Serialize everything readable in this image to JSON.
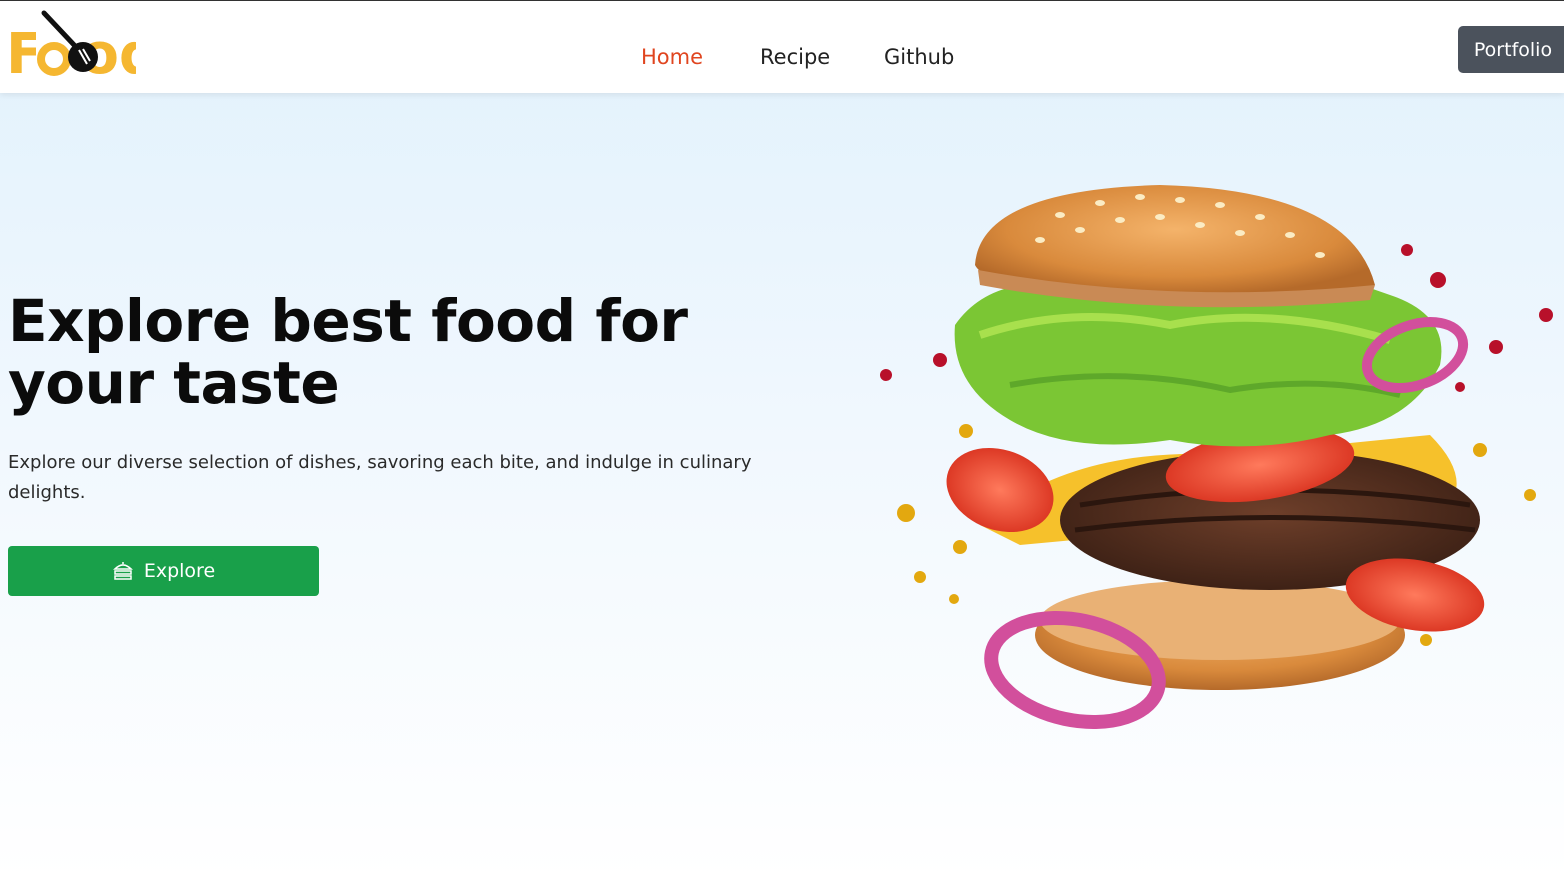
{
  "brand": {
    "logo_text": "Food"
  },
  "nav": {
    "items": [
      {
        "label": "Home",
        "active": true
      },
      {
        "label": "Recipe",
        "active": false
      },
      {
        "label": "Github",
        "active": false
      }
    ],
    "portfolio_label": "Portfolio"
  },
  "hero": {
    "title": "Explore best food for your taste",
    "description": "Explore our diverse selection of dishes, savoring each bite, and indulge in culinary delights.",
    "cta_label": "Explore",
    "cta_icon": "food-tray-icon"
  },
  "colors": {
    "brand_yellow": "#f5b731",
    "active_link": "#e0451f",
    "cta_green": "#19a04a",
    "portfolio_bg": "#4b525c"
  }
}
